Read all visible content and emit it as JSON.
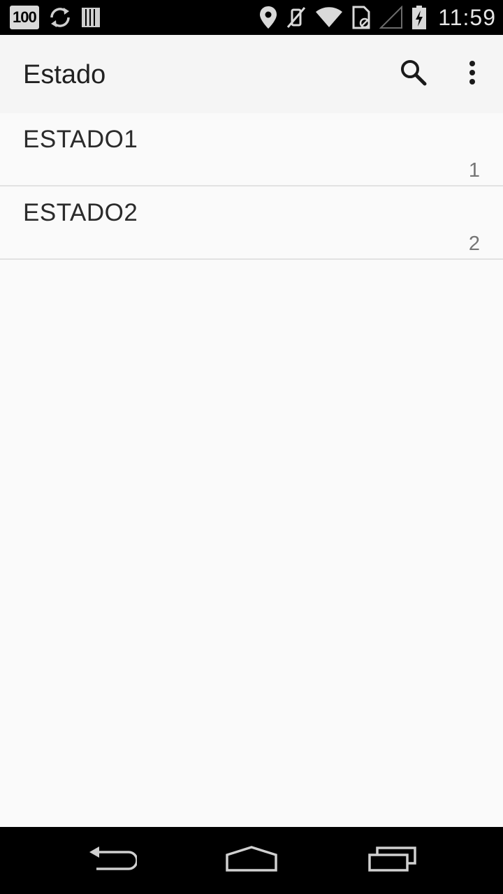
{
  "status_bar": {
    "badge_text": "100",
    "time": "11:59",
    "icons": [
      "badge-100-icon",
      "sync-icon",
      "storage-bars-icon",
      "location-icon",
      "vibrate-off-icon",
      "wifi-icon",
      "no-sim-icon",
      "signal-empty-icon",
      "battery-charging-icon"
    ]
  },
  "toolbar": {
    "title": "Estado",
    "actions": [
      "search-icon",
      "overflow-menu-icon"
    ]
  },
  "list": {
    "items": [
      {
        "title": "ESTADO1",
        "count": "1"
      },
      {
        "title": "ESTADO2",
        "count": "2"
      }
    ]
  },
  "nav_bar": {
    "buttons": [
      "back-icon",
      "home-icon",
      "recents-icon"
    ]
  },
  "colors": {
    "status_bar_bg": "#000000",
    "toolbar_bg": "#f5f5f5",
    "background": "#fafafa",
    "divider": "#e2e2e2"
  }
}
